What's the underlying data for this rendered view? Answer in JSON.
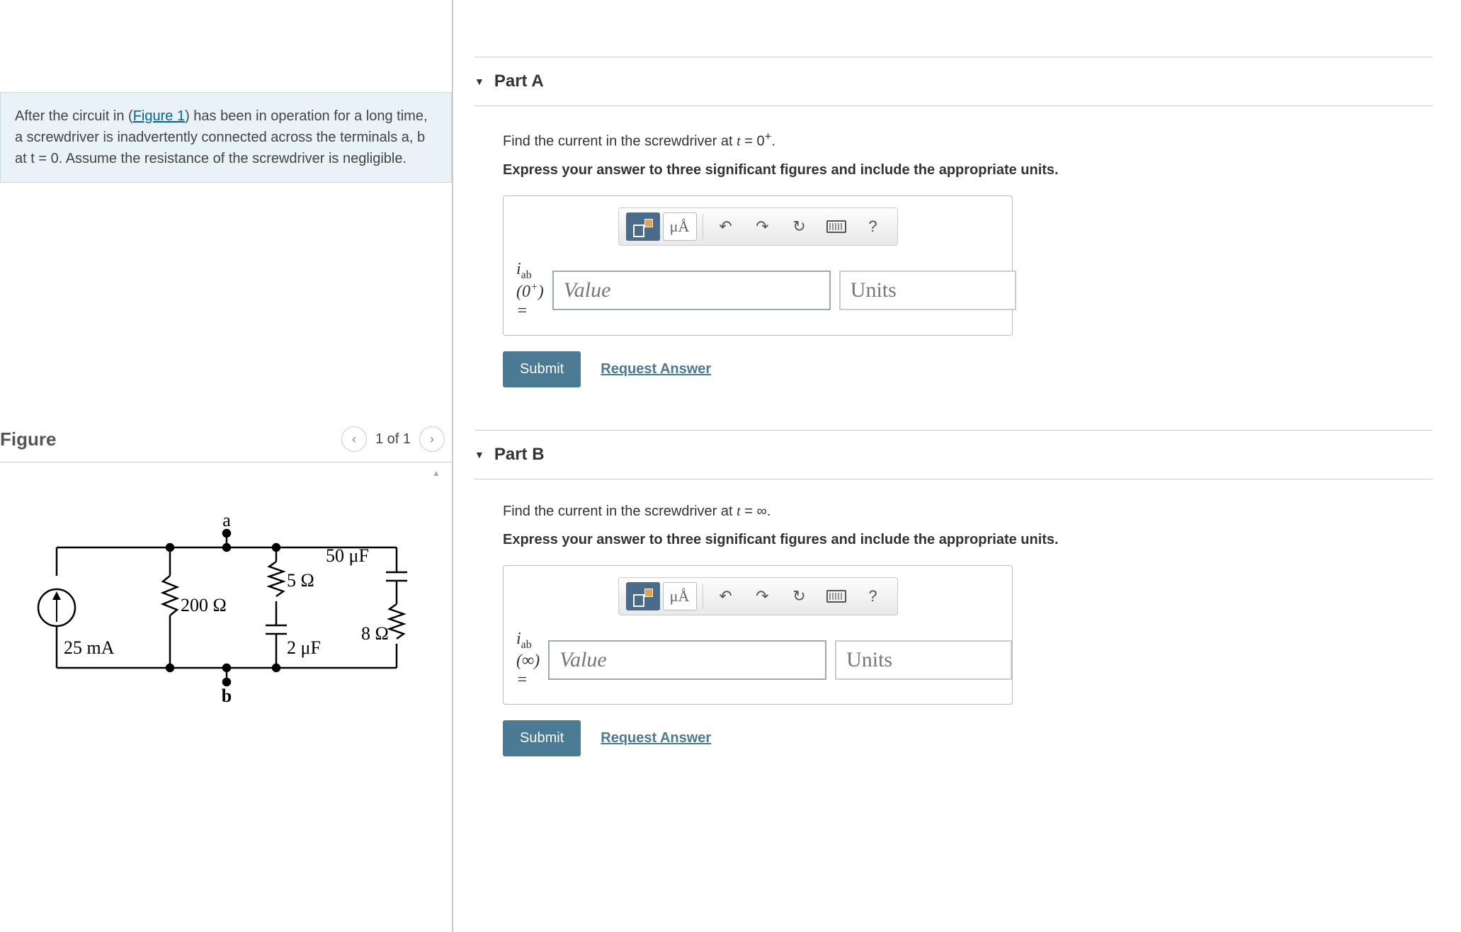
{
  "problem": {
    "text_before_link": "After the circuit in (",
    "figure_link": "Figure 1",
    "text_after_link": ") has been in operation for a long time, a screwdriver is inadvertently connected across the terminals a, b at t = 0. Assume the resistance of the screwdriver is negligible."
  },
  "figure": {
    "title": "Figure",
    "page_indicator": "1 of 1",
    "circuit_labels": {
      "terminal_a": "a",
      "terminal_b": "b",
      "current_source": "25 mA",
      "resistor1": "200 Ω",
      "resistor2": "5 Ω",
      "resistor3": "8 Ω",
      "cap1": "2 μF",
      "cap2": "50 μF"
    }
  },
  "parts": {
    "a": {
      "title": "Part A",
      "prompt_prefix": "Find the current in the screwdriver at ",
      "prompt_math": "t = 0⁺",
      "prompt_suffix": ".",
      "instruction": "Express your answer to three significant figures and include the appropriate units.",
      "label_html": "iab (0⁺) =",
      "value_placeholder": "Value",
      "units_placeholder": "Units",
      "submit": "Submit",
      "request": "Request Answer",
      "units_button": "μÅ"
    },
    "b": {
      "title": "Part B",
      "prompt_prefix": "Find the current in the screwdriver at ",
      "prompt_math": "t = ∞",
      "prompt_suffix": ".",
      "instruction": "Express your answer to three significant figures and include the appropriate units.",
      "label_html": "iab (∞) =",
      "value_placeholder": "Value",
      "units_placeholder": "Units",
      "submit": "Submit",
      "request": "Request Answer",
      "units_button": "μÅ"
    }
  },
  "toolbar": {
    "help": "?"
  }
}
